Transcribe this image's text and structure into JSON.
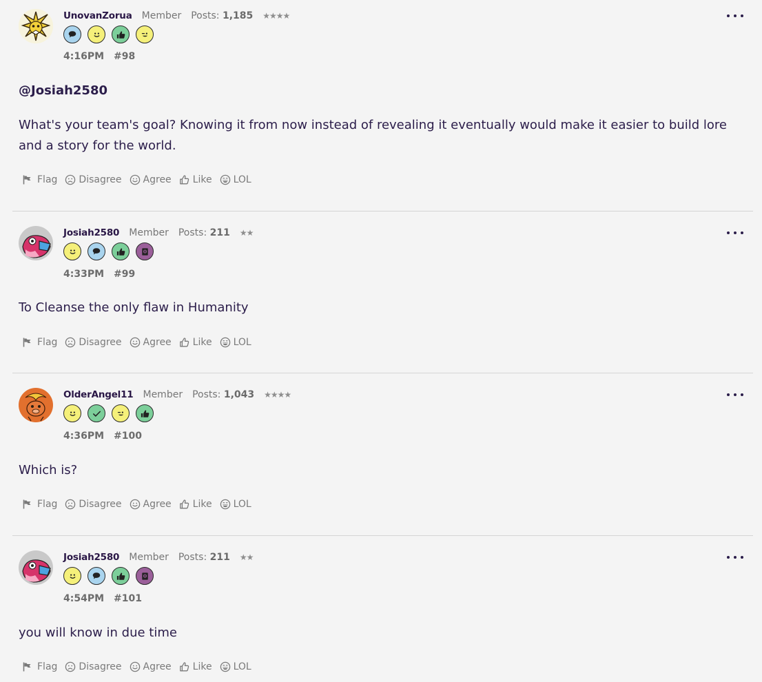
{
  "posts": [
    {
      "username": "UnovanZorua",
      "role": "Member",
      "posts_label": "Posts:",
      "posts_count": "1,185",
      "stars": "★★★★",
      "time": "4:16PM",
      "number": "#98",
      "mention": "@Josiah2580",
      "text": "What's your team's goal? Knowing it from now instead of revealing it eventually would make it easier to build lore and a story for the world."
    },
    {
      "username": "Josiah2580",
      "role": "Member",
      "posts_label": "Posts:",
      "posts_count": "211",
      "stars": "★★",
      "time": "4:33PM",
      "number": "#99",
      "text": "To Cleanse the only flaw in Humanity"
    },
    {
      "username": "OlderAngel11",
      "role": "Member",
      "posts_label": "Posts:",
      "posts_count": "1,043",
      "stars": "★★★★",
      "time": "4:36PM",
      "number": "#100",
      "text": "Which is?"
    },
    {
      "username": "Josiah2580",
      "role": "Member",
      "posts_label": "Posts:",
      "posts_count": "211",
      "stars": "★★",
      "time": "4:54PM",
      "number": "#101",
      "text": "you will know in due time"
    }
  ],
  "actions": {
    "flag": "Flag",
    "disagree": "Disagree",
    "agree": "Agree",
    "like": "Like",
    "lol": "LOL"
  },
  "badge_icons": {
    "post0": [
      "speech-bubble-icon",
      "smile-icon",
      "thumbs-up-icon",
      "wink-icon"
    ],
    "post1": [
      "smile-icon",
      "speech-bubble-icon",
      "thumbs-up-icon",
      "book-icon"
    ],
    "post2": [
      "smile-icon",
      "check-icon",
      "wink-icon",
      "thumbs-up-icon"
    ],
    "post3": [
      "smile-icon",
      "speech-bubble-icon",
      "thumbs-up-icon",
      "book-icon"
    ]
  },
  "colors": {
    "background": "#f4f4f4",
    "text": "#2b1d4a",
    "muted": "#767676",
    "badge_blue": "#a9d4ee",
    "badge_yellow": "#f5f07a",
    "badge_green": "#7ccf9a",
    "badge_purple": "#9b5f9a"
  }
}
